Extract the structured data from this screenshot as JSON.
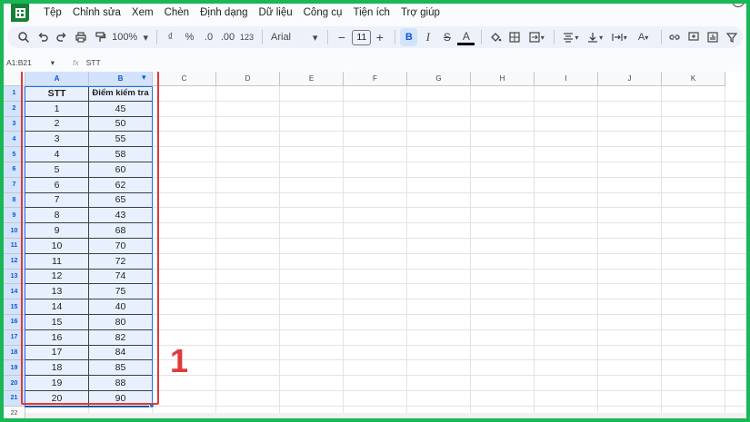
{
  "menu": [
    "Tệp",
    "Chỉnh sửa",
    "Xem",
    "Chèn",
    "Định dạng",
    "Dữ liệu",
    "Công cụ",
    "Tiện ích",
    "Trợ giúp"
  ],
  "toolbar": {
    "zoom": "100%",
    "currency": "₫",
    "percent": "%",
    "dec_decrease": ".0",
    "dec_increase": ".00",
    "number_format": "123",
    "font": "Arial",
    "font_size": "11"
  },
  "formula_bar": {
    "name_box": "A1:B21",
    "content": "STT"
  },
  "columns": [
    "A",
    "B",
    "C",
    "D",
    "E",
    "F",
    "G",
    "H",
    "I",
    "J",
    "K"
  ],
  "rows": [
    "1",
    "2",
    "3",
    "4",
    "5",
    "6",
    "7",
    "8",
    "9",
    "10",
    "11",
    "12",
    "13",
    "14",
    "15",
    "16",
    "17",
    "18",
    "19",
    "20",
    "21",
    "22"
  ],
  "table": {
    "headers": [
      "STT",
      "Điểm kiểm tra"
    ],
    "data": [
      [
        "1",
        "45"
      ],
      [
        "2",
        "50"
      ],
      [
        "3",
        "55"
      ],
      [
        "4",
        "58"
      ],
      [
        "5",
        "60"
      ],
      [
        "6",
        "62"
      ],
      [
        "7",
        "65"
      ],
      [
        "8",
        "43"
      ],
      [
        "9",
        "68"
      ],
      [
        "10",
        "70"
      ],
      [
        "11",
        "72"
      ],
      [
        "12",
        "74"
      ],
      [
        "13",
        "75"
      ],
      [
        "14",
        "40"
      ],
      [
        "15",
        "80"
      ],
      [
        "16",
        "82"
      ],
      [
        "17",
        "84"
      ],
      [
        "18",
        "85"
      ],
      [
        "19",
        "88"
      ],
      [
        "20",
        "90"
      ]
    ]
  },
  "annotation": "1",
  "colors": {
    "frame": "#19b755",
    "highlight": "#e03a3a",
    "selection": "#1a73e8"
  }
}
